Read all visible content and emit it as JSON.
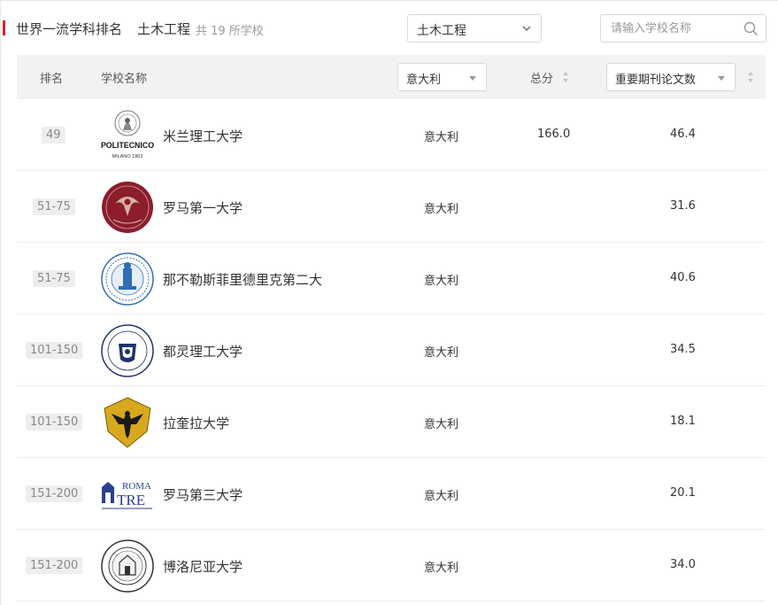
{
  "header": {
    "title": "世界一流学科排名",
    "subject": "土木工程",
    "count_text": "共 19 所学校",
    "subject_select_value": "土木工程",
    "search_placeholder": "请输入学校名称"
  },
  "table": {
    "columns": {
      "rank": "排名",
      "school": "学校名称",
      "country_filter": "意大利",
      "score": "总分",
      "indicator_select": "重要期刊论文数"
    },
    "rows": [
      {
        "rank": "49",
        "name": "米兰理工大学",
        "country": "意大利",
        "score": "166.0",
        "papers": "46.4",
        "logo": "politecnico-milano-logo"
      },
      {
        "rank": "51-75",
        "name": "罗马第一大学",
        "country": "意大利",
        "score": "",
        "papers": "31.6",
        "logo": "sapienza-logo"
      },
      {
        "rank": "51-75",
        "name": "那不勒斯菲里德里克第二大学",
        "country": "意大利",
        "score": "",
        "papers": "40.6",
        "logo": "federico-ii-logo"
      },
      {
        "rank": "101-150",
        "name": "都灵理工大学",
        "country": "意大利",
        "score": "",
        "papers": "34.5",
        "logo": "politecnico-torino-logo"
      },
      {
        "rank": "101-150",
        "name": "拉奎拉大学",
        "country": "意大利",
        "score": "",
        "papers": "18.1",
        "logo": "laquila-logo"
      },
      {
        "rank": "151-200",
        "name": "罗马第三大学",
        "country": "意大利",
        "score": "",
        "papers": "20.1",
        "logo": "roma-tre-logo"
      },
      {
        "rank": "151-200",
        "name": "博洛尼亚大学",
        "country": "意大利",
        "score": "",
        "papers": "34.0",
        "logo": "bologna-logo"
      }
    ]
  },
  "logo_text": {
    "polimi_main": "POLITECNICO",
    "polimi_sub": "MILANO 1863",
    "roma_tre_top": "ROMA",
    "roma_tre_bottom": "TRE"
  },
  "colors": {
    "accent": "#d71e30",
    "header_bg": "#f2f2f2",
    "badge_bg": "#eeeeee",
    "sapienza": "#8b1d2c",
    "federico_blue": "#2f6db5",
    "torino_navy": "#1f3566",
    "laquila_gold": "#d8a81f",
    "roma_tre_blue": "#2a3f8f"
  }
}
